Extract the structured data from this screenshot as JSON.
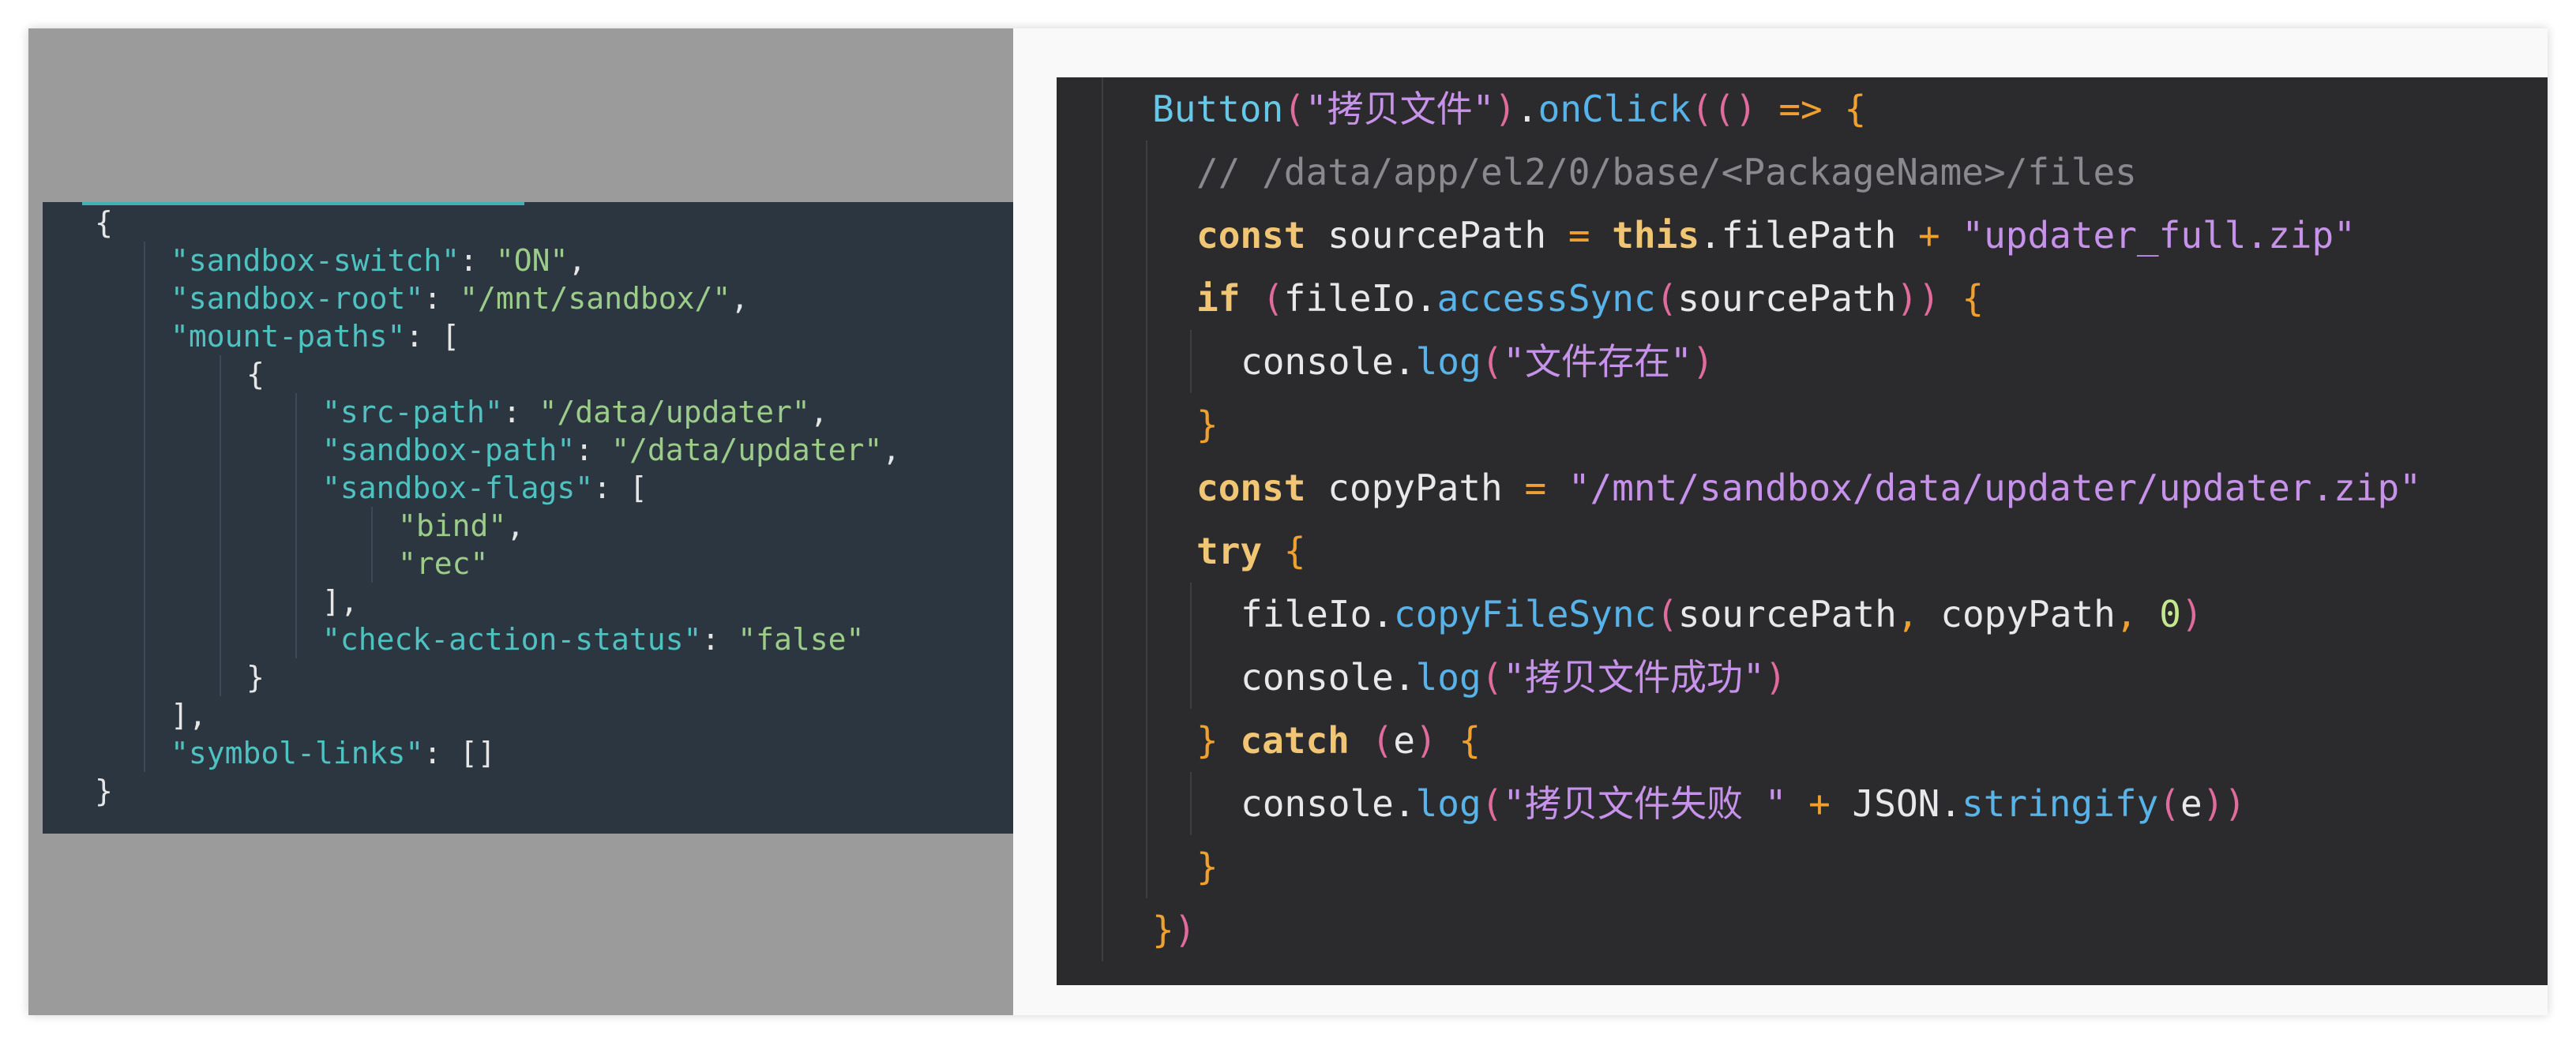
{
  "json_panel": {
    "lines": [
      {
        "indent": 1,
        "parts": [
          [
            "pun",
            "{"
          ]
        ]
      },
      {
        "indent": 2,
        "parts": [
          [
            "key",
            "\"sandbox-switch\""
          ],
          [
            "pun",
            ": "
          ],
          [
            "str",
            "\"ON\""
          ],
          [
            "pun",
            ","
          ]
        ]
      },
      {
        "indent": 2,
        "parts": [
          [
            "key",
            "\"sandbox-root\""
          ],
          [
            "pun",
            ": "
          ],
          [
            "str",
            "\"/mnt/sandbox/\""
          ],
          [
            "pun",
            ","
          ]
        ]
      },
      {
        "indent": 2,
        "parts": [
          [
            "key",
            "\"mount-paths\""
          ],
          [
            "pun",
            ": ["
          ]
        ]
      },
      {
        "indent": 3,
        "parts": [
          [
            "pun",
            "{"
          ]
        ]
      },
      {
        "indent": 4,
        "parts": [
          [
            "key",
            "\"src-path\""
          ],
          [
            "pun",
            ": "
          ],
          [
            "str",
            "\"/data/updater\""
          ],
          [
            "pun",
            ","
          ]
        ]
      },
      {
        "indent": 4,
        "parts": [
          [
            "key",
            "\"sandbox-path\""
          ],
          [
            "pun",
            ": "
          ],
          [
            "str",
            "\"/data/updater\""
          ],
          [
            "pun",
            ","
          ]
        ]
      },
      {
        "indent": 4,
        "parts": [
          [
            "key",
            "\"sandbox-flags\""
          ],
          [
            "pun",
            ": ["
          ]
        ]
      },
      {
        "indent": 5,
        "parts": [
          [
            "str",
            "\"bind\""
          ],
          [
            "pun",
            ","
          ]
        ]
      },
      {
        "indent": 5,
        "parts": [
          [
            "str",
            "\"rec\""
          ]
        ]
      },
      {
        "indent": 4,
        "parts": [
          [
            "pun",
            "],"
          ]
        ]
      },
      {
        "indent": 4,
        "parts": [
          [
            "key",
            "\"check-action-status\""
          ],
          [
            "pun",
            ": "
          ],
          [
            "str",
            "\"false\""
          ]
        ]
      },
      {
        "indent": 3,
        "parts": [
          [
            "pun",
            "}"
          ]
        ]
      },
      {
        "indent": 2,
        "parts": [
          [
            "pun",
            "],"
          ]
        ]
      },
      {
        "indent": 2,
        "parts": [
          [
            "key",
            "\"symbol-links\""
          ],
          [
            "pun",
            ": []"
          ]
        ]
      },
      {
        "indent": 1,
        "parts": [
          [
            "pun",
            "}"
          ]
        ]
      }
    ]
  },
  "code_panel": {
    "lines": [
      {
        "indent": 0,
        "parts": [
          [
            "type",
            "Button"
          ],
          [
            "br2",
            "("
          ],
          [
            "str",
            "\"拷贝文件\""
          ],
          [
            "br2",
            ")"
          ],
          [
            "pun",
            "."
          ],
          [
            "fn",
            "onClick"
          ],
          [
            "br2",
            "(("
          ],
          [
            "br2",
            ")"
          ],
          [
            "pun",
            " "
          ],
          [
            "op",
            "=>"
          ],
          [
            "pun",
            " "
          ],
          [
            "br1",
            "{"
          ]
        ]
      },
      {
        "indent": 1,
        "parts": [
          [
            "com",
            "// /data/app/el2/0/base/<PackageName>/files"
          ]
        ]
      },
      {
        "indent": 1,
        "parts": [
          [
            "kw",
            "const"
          ],
          [
            "pun",
            " sourcePath "
          ],
          [
            "op",
            "="
          ],
          [
            "pun",
            " "
          ],
          [
            "kw",
            "this"
          ],
          [
            "pun",
            ".filePath "
          ],
          [
            "op",
            "+"
          ],
          [
            "pun",
            " "
          ],
          [
            "str",
            "\"updater_full.zip\""
          ]
        ]
      },
      {
        "indent": 1,
        "parts": [
          [
            "kw",
            "if"
          ],
          [
            "pun",
            " "
          ],
          [
            "br2",
            "("
          ],
          [
            "pun",
            "fileIo."
          ],
          [
            "fn",
            "accessSync"
          ],
          [
            "br2",
            "("
          ],
          [
            "pun",
            "sourcePath"
          ],
          [
            "br2",
            "))"
          ],
          [
            "pun",
            " "
          ],
          [
            "br1",
            "{"
          ]
        ]
      },
      {
        "indent": 2,
        "parts": [
          [
            "pun",
            "console."
          ],
          [
            "fn",
            "log"
          ],
          [
            "br2",
            "("
          ],
          [
            "str",
            "\"文件存在\""
          ],
          [
            "br2",
            ")"
          ]
        ]
      },
      {
        "indent": 1,
        "parts": [
          [
            "br1",
            "}"
          ]
        ]
      },
      {
        "indent": 1,
        "parts": [
          [
            "kw",
            "const"
          ],
          [
            "pun",
            " copyPath "
          ],
          [
            "op",
            "="
          ],
          [
            "pun",
            " "
          ],
          [
            "str",
            "\"/mnt/sandbox/data/updater/updater.zip\""
          ]
        ]
      },
      {
        "indent": 1,
        "parts": [
          [
            "kw",
            "try"
          ],
          [
            "pun",
            " "
          ],
          [
            "br1",
            "{"
          ]
        ]
      },
      {
        "indent": 2,
        "parts": [
          [
            "pun",
            "fileIo."
          ],
          [
            "fn",
            "copyFileSync"
          ],
          [
            "br2",
            "("
          ],
          [
            "pun",
            "sourcePath"
          ],
          [
            "op",
            ","
          ],
          [
            "pun",
            " copyPath"
          ],
          [
            "op",
            ","
          ],
          [
            "pun",
            " "
          ],
          [
            "num",
            "0"
          ],
          [
            "br2",
            ")"
          ]
        ]
      },
      {
        "indent": 2,
        "parts": [
          [
            "pun",
            "console."
          ],
          [
            "fn",
            "log"
          ],
          [
            "br2",
            "("
          ],
          [
            "str",
            "\"拷贝文件成功\""
          ],
          [
            "br2",
            ")"
          ]
        ]
      },
      {
        "indent": 1,
        "parts": [
          [
            "br1",
            "}"
          ],
          [
            "pun",
            " "
          ],
          [
            "kw",
            "catch"
          ],
          [
            "pun",
            " "
          ],
          [
            "br2",
            "("
          ],
          [
            "pun",
            "e"
          ],
          [
            "br2",
            ")"
          ],
          [
            "pun",
            " "
          ],
          [
            "br1",
            "{"
          ]
        ]
      },
      {
        "indent": 2,
        "parts": [
          [
            "pun",
            "console."
          ],
          [
            "fn",
            "log"
          ],
          [
            "br2",
            "("
          ],
          [
            "str",
            "\"拷贝文件失败 \""
          ],
          [
            "pun",
            " "
          ],
          [
            "op",
            "+"
          ],
          [
            "pun",
            " JSON."
          ],
          [
            "fn",
            "stringify"
          ],
          [
            "br2",
            "("
          ],
          [
            "pun",
            "e"
          ],
          [
            "br2",
            "))"
          ]
        ]
      },
      {
        "indent": 1,
        "parts": [
          [
            "br1",
            "}"
          ]
        ]
      },
      {
        "indent": 0,
        "parts": [
          [
            "br1",
            "}"
          ],
          [
            "br2",
            ")"
          ]
        ]
      }
    ]
  },
  "colors": {
    "json_background": "#2b3641",
    "code_background": "#2b2b2e",
    "left_backdrop": "#9b9b9b"
  }
}
